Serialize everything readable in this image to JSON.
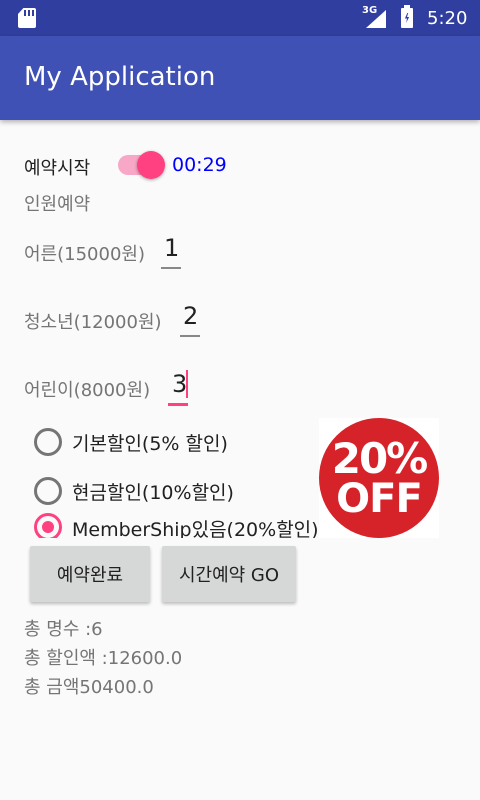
{
  "status_bar": {
    "network": "3G",
    "time": "5:20",
    "icons": [
      "sd-card-icon",
      "signal-icon",
      "battery-charging-icon"
    ]
  },
  "app_bar": {
    "title": "My Application"
  },
  "reservation": {
    "start_label": "예약시작",
    "switch_on": true,
    "timer": "00:29",
    "people_label": "인원예약",
    "adult_label": "어른(15000원)",
    "adult_value": "1",
    "youth_label": "청소년(12000원)",
    "youth_value": "2",
    "child_label": "어린이(8000원)",
    "child_value": "3"
  },
  "discounts": {
    "options": [
      "기본할인(5% 할인)",
      "현금할인(10%할인)",
      "MemberShip있음(20%할인)"
    ],
    "selected_index": 2
  },
  "badge": {
    "line1": "20%",
    "line2": "OFF"
  },
  "buttons": {
    "complete": "예약완료",
    "timed": "시간예약 GO"
  },
  "summary": {
    "total_people": "총 명수 :6",
    "total_discount": "총 할인액 :12600.0",
    "total_amount": "총 금액50400.0"
  },
  "colors": {
    "primary": "#3f51b5",
    "primary_dark": "#303f9f",
    "accent": "#ff4081",
    "timer": "#0000ff",
    "badge": "#d6232a"
  }
}
